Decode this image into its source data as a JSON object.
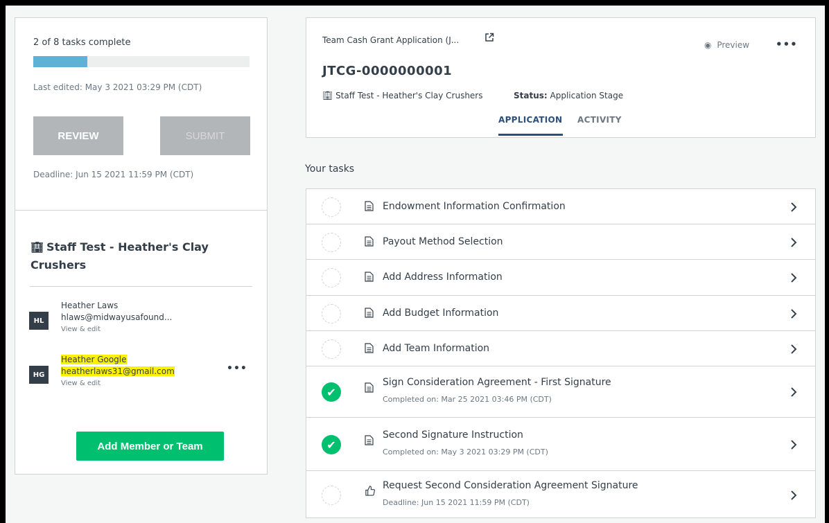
{
  "progress": {
    "text": "2 of 8 tasks complete",
    "fraction": 0.25,
    "color": "#5fb2d6"
  },
  "last_edited": "Last edited: May 3 2021 03:29 PM (CDT)",
  "buttons": {
    "review": "REVIEW",
    "submit": "SUBMIT",
    "add_member": "Add Member or Team"
  },
  "deadline": "Deadline: Jun 15 2021 11:59 PM (CDT)",
  "team": {
    "icon": "building-icon",
    "name": "Staff Test - Heather's Clay Crushers"
  },
  "members": [
    {
      "initials": "HL",
      "name": "Heather Laws",
      "email": "hlaws@midwayusafound...",
      "edit": "View & edit"
    },
    {
      "initials": "HG",
      "name": "Heather Google",
      "email": "heatherlaws31@gmail.com",
      "edit": "View & edit",
      "more": "•••"
    }
  ],
  "header": {
    "subtitle": "Team Cash Grant Application (J...",
    "preview": "Preview",
    "more": "•••",
    "id": "JTCG-0000000001",
    "team": "Staff Test - Heather's Clay Crushers",
    "status_label": "Status:",
    "status_value": "Application Stage",
    "tabs": {
      "application": "APPLICATION",
      "activity": "ACTIVITY"
    }
  },
  "tasks_heading": "Your tasks",
  "tasks": [
    {
      "title": "Endowment Information Confirmation",
      "done": false,
      "icon": "document-icon"
    },
    {
      "title": "Payout Method Selection",
      "done": false,
      "icon": "document-icon"
    },
    {
      "title": "Add Address Information",
      "done": false,
      "icon": "document-icon"
    },
    {
      "title": "Add Budget Information",
      "done": false,
      "icon": "document-icon"
    },
    {
      "title": "Add Team Information",
      "done": false,
      "icon": "document-icon"
    },
    {
      "title": "Sign Consideration Agreement - First Signature",
      "sub": "Completed on: Mar 25 2021 03:46 PM (CDT)",
      "done": true,
      "icon": "document-icon"
    },
    {
      "title": "Second Signature Instruction",
      "sub": "Completed on: May 3 2021 03:29 PM (CDT)",
      "done": true,
      "icon": "document-icon"
    },
    {
      "title": "Request Second Consideration Agreement Signature",
      "sub": "Deadline: Jun 15 2021 11:59 PM (CDT)",
      "done": false,
      "icon": "thumbs-up-icon"
    }
  ]
}
